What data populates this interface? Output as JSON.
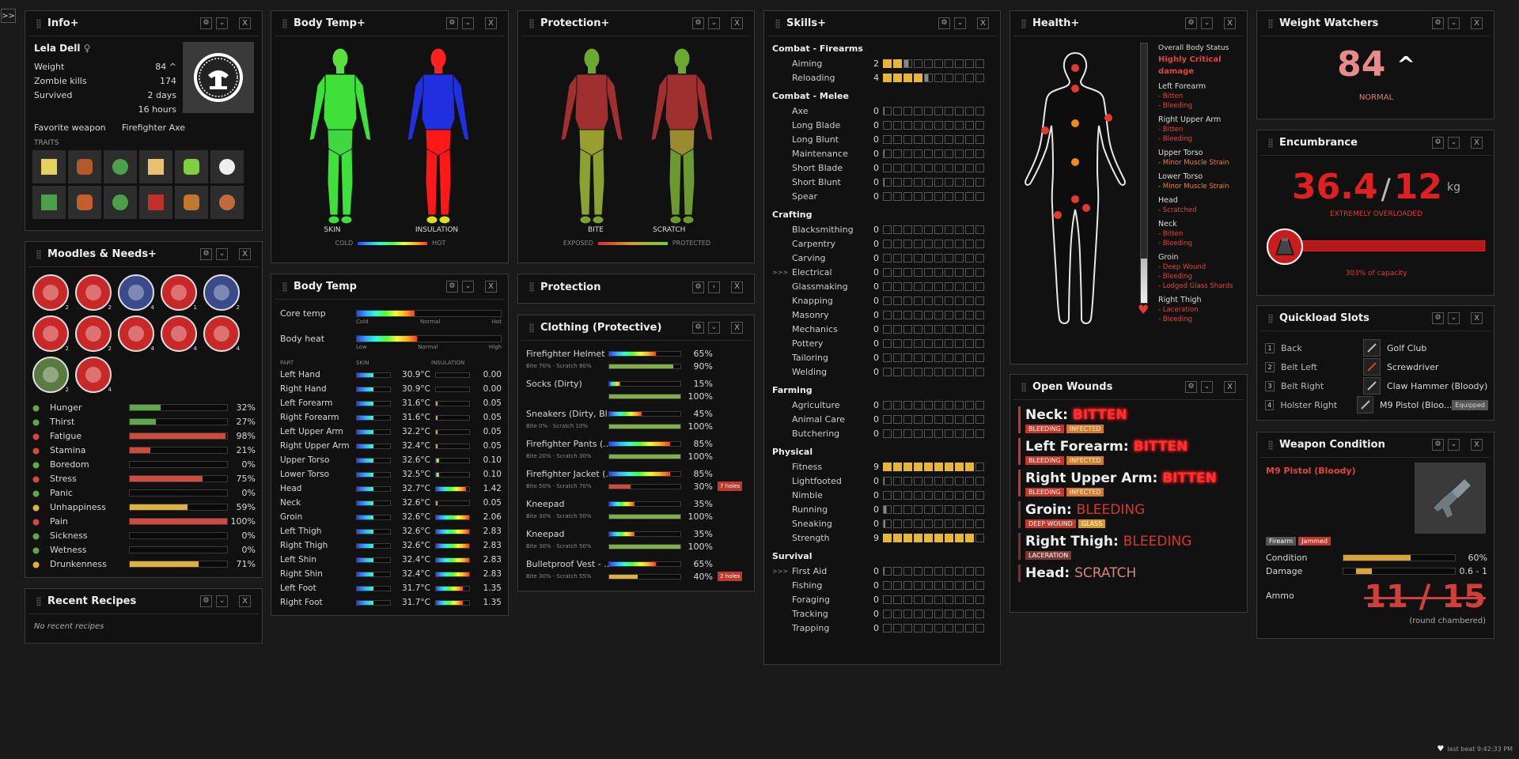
{
  "toggle": ">>",
  "common": {
    "settings": "⚙",
    "collapse": "⌄",
    "close": "X"
  },
  "info": {
    "title": "Info+",
    "name": "Lela Dell",
    "gender": "♀",
    "weight_label": "Weight",
    "weight": "84",
    "weight_arrow": "^",
    "kills_label": "Zombie kills",
    "kills": "174",
    "survived_label": "Survived",
    "survived_days": "2 days",
    "survived_hours": "16 hours",
    "fav_label": "Favorite weapon",
    "fav": "Firefighter Axe",
    "traits_label": "TRAITS"
  },
  "moodles": {
    "title": "Moodles & Needs+",
    "badges": [
      "2",
      "2",
      "4",
      "1",
      "2",
      "2",
      "2",
      "4",
      "4",
      "4",
      "2",
      "4"
    ],
    "needs": [
      {
        "n": "Hunger",
        "v": "32%",
        "p": 32,
        "c": "#5fa84a"
      },
      {
        "n": "Thirst",
        "v": "27%",
        "p": 27,
        "c": "#5fa84a"
      },
      {
        "n": "Fatigue",
        "v": "98%",
        "p": 98,
        "c": "#d14a3f"
      },
      {
        "n": "Stamina",
        "v": "21%",
        "p": 21,
        "c": "#d14a3f"
      },
      {
        "n": "Boredom",
        "v": "0%",
        "p": 0,
        "c": "#5fa84a"
      },
      {
        "n": "Stress",
        "v": "75%",
        "p": 75,
        "c": "#d14a3f"
      },
      {
        "n": "Panic",
        "v": "0%",
        "p": 0,
        "c": "#5fa84a"
      },
      {
        "n": "Unhappiness",
        "v": "59%",
        "p": 59,
        "c": "#e0b040"
      },
      {
        "n": "Pain",
        "v": "100%",
        "p": 100,
        "c": "#d14a3f"
      },
      {
        "n": "Sickness",
        "v": "0%",
        "p": 0,
        "c": "#5fa84a"
      },
      {
        "n": "Wetness",
        "v": "0%",
        "p": 0,
        "c": "#5fa84a"
      },
      {
        "n": "Drunkenness",
        "v": "71%",
        "p": 71,
        "c": "#e0b040"
      }
    ]
  },
  "recipes": {
    "title": "Recent Recipes",
    "empty": "No recent recipes"
  },
  "bodytemp_plus": {
    "title": "Body Temp+",
    "skin": "SKIN",
    "insulation": "INSULATION",
    "cold": "COLD",
    "hot": "HOT"
  },
  "bodytemp": {
    "title": "Body Temp",
    "core": "Core temp",
    "heat": "Body heat",
    "cold": "Cold",
    "normal": "Normal",
    "hot": "Hot",
    "low": "Low",
    "high": "High",
    "part": "PART",
    "skin": "SKIN",
    "insulation": "INSULATION",
    "rows": [
      [
        "Left Hand",
        "30.9°C",
        "0.00",
        0.5,
        0
      ],
      [
        "Right Hand",
        "30.9°C",
        "0.00",
        0.5,
        0
      ],
      [
        "Left Forearm",
        "31.6°C",
        "0.05",
        0.5,
        0.05
      ],
      [
        "Right Forearm",
        "31.6°C",
        "0.05",
        0.5,
        0.05
      ],
      [
        "Left Upper Arm",
        "32.2°C",
        "0.05",
        0.5,
        0.05
      ],
      [
        "Right Upper Arm",
        "32.4°C",
        "0.05",
        0.5,
        0.05
      ],
      [
        "Upper Torso",
        "32.6°C",
        "0.10",
        0.5,
        0.1
      ],
      [
        "Lower Torso",
        "32.5°C",
        "0.10",
        0.5,
        0.1
      ],
      [
        "Head",
        "32.7°C",
        "1.42",
        0.5,
        0.9
      ],
      [
        "Neck",
        "32.6°C",
        "0.05",
        0.5,
        0.05
      ],
      [
        "Groin",
        "32.6°C",
        "2.06",
        0.5,
        1
      ],
      [
        "Left Thigh",
        "32.6°C",
        "2.83",
        0.5,
        1
      ],
      [
        "Right Thigh",
        "32.6°C",
        "2.83",
        0.5,
        1
      ],
      [
        "Left Shin",
        "32.4°C",
        "2.83",
        0.5,
        1
      ],
      [
        "Right Shin",
        "32.4°C",
        "2.83",
        0.5,
        1
      ],
      [
        "Left Foot",
        "31.7°C",
        "1.35",
        0.5,
        0.8
      ],
      [
        "Right Foot",
        "31.7°C",
        "1.35",
        0.5,
        0.8
      ]
    ]
  },
  "protection_plus": {
    "title": "Protection+",
    "bite": "BITE",
    "scratch": "SCRATCH",
    "exposed": "EXPOSED",
    "protected": "PROTECTED"
  },
  "protection": {
    "title": "Protection",
    "chevron": "›"
  },
  "clothing": {
    "title": "Clothing (Protective)",
    "items": [
      {
        "n": "Firefighter Helmet ...",
        "s": "Bite 70% · Scratch 80%",
        "v1": "65%",
        "p1": 65,
        "v2": "90%",
        "p2": 90,
        "c2": "#7fb04a",
        "h": ""
      },
      {
        "n": "Socks (Dirty)",
        "s": "",
        "v1": "15%",
        "p1": 15,
        "v2": "100%",
        "p2": 100,
        "c2": "#7fb04a",
        "h": ""
      },
      {
        "n": "Sneakers (Dirty, Bl...",
        "s": "Bite 0% · Scratch 10%",
        "v1": "45%",
        "p1": 45,
        "v2": "100%",
        "p2": 100,
        "c2": "#7fb04a",
        "h": ""
      },
      {
        "n": "Firefighter Pants (...",
        "s": "Bite 20% · Scratch 30%",
        "v1": "85%",
        "p1": 85,
        "v2": "100%",
        "p2": 100,
        "c2": "#7fb04a",
        "h": ""
      },
      {
        "n": "Firefighter Jacket (...",
        "s": "Bite 50% · Scratch 70%",
        "v1": "85%",
        "p1": 85,
        "v2": "30%",
        "p2": 30,
        "c2": "#d14a3f",
        "h": "7 holes"
      },
      {
        "n": "Kneepad",
        "s": "Bite 30% · Scratch 50%",
        "v1": "35%",
        "p1": 35,
        "v2": "100%",
        "p2": 100,
        "c2": "#7fb04a",
        "h": ""
      },
      {
        "n": "Kneepad",
        "s": "Bite 30% · Scratch 50%",
        "v1": "35%",
        "p1": 35,
        "v2": "100%",
        "p2": 100,
        "c2": "#7fb04a",
        "h": ""
      },
      {
        "n": "Bulletproof Vest - ...",
        "s": "Bite 30% · Scratch 55%",
        "v1": "65%",
        "p1": 65,
        "v2": "40%",
        "p2": 40,
        "c2": "#e0b040",
        "h": "2 holes"
      }
    ]
  },
  "skills": {
    "title": "Skills+",
    "groups": [
      {
        "g": "Combat - Firearms",
        "items": [
          [
            "Aiming",
            2,
            0.6,
            ""
          ],
          [
            "Reloading",
            4,
            0.5,
            ""
          ]
        ]
      },
      {
        "g": "Combat - Melee",
        "items": [
          [
            "Axe",
            0,
            0.1,
            ""
          ],
          [
            "Long Blade",
            0,
            0,
            ""
          ],
          [
            "Long Blunt",
            0,
            0,
            ""
          ],
          [
            "Maintenance",
            0,
            0.1,
            ""
          ],
          [
            "Short Blade",
            0,
            0,
            ""
          ],
          [
            "Short Blunt",
            0,
            0.1,
            ""
          ],
          [
            "Spear",
            0,
            0,
            ""
          ]
        ]
      },
      {
        "g": "Crafting",
        "items": [
          [
            "Blacksmithing",
            0,
            0,
            ""
          ],
          [
            "Carpentry",
            0,
            0,
            ""
          ],
          [
            "Carving",
            0,
            0,
            ""
          ],
          [
            "Electrical",
            0,
            0,
            ">>>"
          ],
          [
            "Glassmaking",
            0,
            0,
            ""
          ],
          [
            "Knapping",
            0,
            0,
            ""
          ],
          [
            "Masonry",
            0,
            0,
            ""
          ],
          [
            "Mechanics",
            0,
            0,
            ""
          ],
          [
            "Pottery",
            0,
            0,
            ""
          ],
          [
            "Tailoring",
            0,
            0,
            ""
          ],
          [
            "Welding",
            0,
            0,
            ""
          ]
        ]
      },
      {
        "g": "Farming",
        "items": [
          [
            "Agriculture",
            0,
            0,
            ""
          ],
          [
            "Animal Care",
            0,
            0,
            ""
          ],
          [
            "Butchering",
            0,
            0,
            ""
          ]
        ]
      },
      {
        "g": "Physical",
        "items": [
          [
            "Fitness",
            9,
            0,
            ""
          ],
          [
            "Lightfooted",
            0,
            0.1,
            ""
          ],
          [
            "Nimble",
            0,
            0,
            ""
          ],
          [
            "Running",
            0,
            0.4,
            ""
          ],
          [
            "Sneaking",
            0,
            0.2,
            ""
          ],
          [
            "Strength",
            9,
            0,
            ""
          ]
        ]
      },
      {
        "g": "Survival",
        "items": [
          [
            "First Aid",
            0,
            0.1,
            ">>>"
          ],
          [
            "Fishing",
            0,
            0,
            ""
          ],
          [
            "Foraging",
            0,
            0,
            ""
          ],
          [
            "Tracking",
            0,
            0,
            ""
          ],
          [
            "Trapping",
            0,
            0,
            ""
          ]
        ]
      }
    ]
  },
  "health": {
    "title": "Health+",
    "overall": "Overall Body Status",
    "status": "Highly Critical damage",
    "heart": "♥",
    "parts": [
      {
        "p": "Left Forearm",
        "w": [
          "- Bitten",
          "- Bleeding"
        ],
        "c": "red"
      },
      {
        "p": "Right Upper Arm",
        "w": [
          "- Bitten",
          "- Bleeding"
        ],
        "c": "red"
      },
      {
        "p": "Upper Torso",
        "w": [
          "- Minor Muscle Strain"
        ],
        "c": "orange"
      },
      {
        "p": "Lower Torso",
        "w": [
          "- Minor Muscle Strain"
        ],
        "c": "orange"
      },
      {
        "p": "Head",
        "w": [
          "- Scratched"
        ],
        "c": "red"
      },
      {
        "p": "Neck",
        "w": [
          "- Bitten",
          "- Bleeding"
        ],
        "c": "red"
      },
      {
        "p": "Groin",
        "w": [
          "- Deep Wound",
          "- Bleeding",
          "- Lodged Glass Shards"
        ],
        "c": "red"
      },
      {
        "p": "Right Thigh",
        "w": [
          "- Laceration",
          "- Bleeding"
        ],
        "c": "red"
      }
    ]
  },
  "wounds": {
    "title": "Open Wounds",
    "items": [
      {
        "p": "Neck:",
        "t": "BITTEN",
        "tags": [
          [
            "BLEEDING",
            "#c0392b"
          ],
          [
            "INFECTED",
            "#d4782a"
          ]
        ],
        "glow": true
      },
      {
        "p": "Left Forearm:",
        "t": "BITTEN",
        "tags": [
          [
            "BLEEDING",
            "#c0392b"
          ],
          [
            "INFECTED",
            "#d4782a"
          ]
        ],
        "glow": true
      },
      {
        "p": "Right Upper Arm:",
        "t": "BITTEN",
        "tags": [
          [
            "BLEEDING",
            "#c0392b"
          ],
          [
            "INFECTED",
            "#d4782a"
          ]
        ],
        "glow": true
      },
      {
        "p": "Groin:",
        "t": "BLEEDING",
        "tags": [
          [
            "DEEP WOUND",
            "#c0392b"
          ],
          [
            "GLASS",
            "#d4982a"
          ]
        ],
        "glow": false
      },
      {
        "p": "Right Thigh:",
        "t": "BLEEDING",
        "tags": [
          [
            "LACERATION",
            "#7a3a34"
          ]
        ],
        "glow": false
      },
      {
        "p": "Head:",
        "t": "SCRATCH",
        "tags": [],
        "glow": false
      }
    ]
  },
  "weight": {
    "title": "Weight Watchers",
    "value": "84",
    "arrow": "^",
    "label": "NORMAL"
  },
  "enc": {
    "title": "Encumbrance",
    "cur": "36.4",
    "sep": "/",
    "max": "12",
    "unit": "kg",
    "status": "EXTREMELY OVERLOADED",
    "cap": "303% of capacity"
  },
  "quick": {
    "title": "Quickload Slots",
    "slots": [
      [
        "1",
        "Back",
        "Golf Club",
        ""
      ],
      [
        "2",
        "Belt Left",
        "Screwdriver",
        ""
      ],
      [
        "3",
        "Belt Right",
        "Claw Hammer (Bloody)",
        ""
      ],
      [
        "4",
        "Holster Right",
        "M9 Pistol (Bloo...",
        "Equipped"
      ]
    ]
  },
  "weapon": {
    "title": "Weapon Condition",
    "name": "M9 Pistol (Bloody)",
    "tags": [
      "Firearm",
      "Jammed"
    ],
    "cond_label": "Condition",
    "cond": "60%",
    "cond_p": 60,
    "dmg_label": "Damage",
    "dmg": "0.6 - 1",
    "ammo_label": "Ammo",
    "ammo": "11 / 15",
    "chamber": "(round chambered)"
  },
  "footer": {
    "heart": "♥",
    "text": "last beat 9:42:33 PM"
  }
}
